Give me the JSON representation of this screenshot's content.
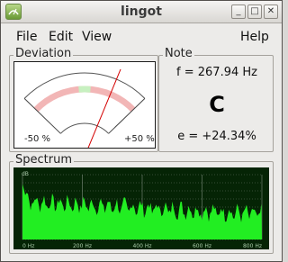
{
  "window": {
    "title": "lingot"
  },
  "menu": {
    "file": "File",
    "edit": "Edit",
    "view": "View",
    "help": "Help"
  },
  "deviation": {
    "label": "Deviation",
    "min_label": "-50 %",
    "max_label": "+50 %",
    "deviation_percent": 24.34
  },
  "note": {
    "label": "Note",
    "frequency": "f = 267.94 Hz",
    "name": "C",
    "error": "e = +24.34%"
  },
  "spectrum": {
    "label": "Spectrum",
    "y_unit": "dB",
    "x_ticks": [
      "0 Hz",
      "200 Hz",
      "400 Hz",
      "600 Hz",
      "800 Hz"
    ]
  },
  "colors": {
    "gauge_arc": "#f2b6b6",
    "gauge_center": "#c7f0c0",
    "gauge_needle": "#d40000",
    "spectrum_bg": "#052405",
    "spectrum_grid": "#7d8c7d",
    "spectrum_fill": "#22ee22",
    "spectrum_text": "#a8c8a8"
  }
}
